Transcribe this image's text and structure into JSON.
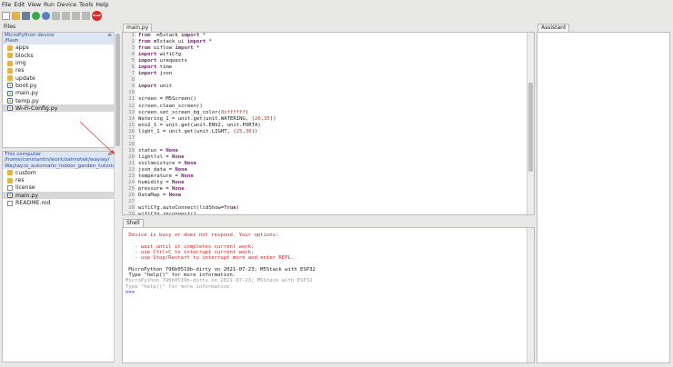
{
  "menu": [
    "File",
    "Edit",
    "View",
    "Run",
    "Device",
    "Tools",
    "Help"
  ],
  "toolbar": {
    "stop_label": "STOP"
  },
  "files_panel": {
    "title": "Files",
    "device": {
      "header": "MicroPython device",
      "path": "/flash",
      "menu_glyph": "≡",
      "items": [
        {
          "name": "apps",
          "type": "folder"
        },
        {
          "name": "blocks",
          "type": "folder"
        },
        {
          "name": "img",
          "type": "folder"
        },
        {
          "name": "res",
          "type": "folder"
        },
        {
          "name": "update",
          "type": "folder"
        },
        {
          "name": "boot.py",
          "type": "py"
        },
        {
          "name": "main.py",
          "type": "py"
        },
        {
          "name": "temp.py",
          "type": "py"
        },
        {
          "name": "Wi-Fi-Config.py",
          "type": "py",
          "selected": true
        }
      ]
    },
    "computer": {
      "header": "This computer",
      "path_line1": "/home/constantin/work/zaimotek/wayiay/",
      "path_line2": "Waylay.io_automatic_indoor_garden_tutorial",
      "menu_glyph": "≡",
      "items": [
        {
          "name": "custom",
          "type": "folder"
        },
        {
          "name": "res",
          "type": "folder"
        },
        {
          "name": "license",
          "type": "txt"
        },
        {
          "name": "main.py",
          "type": "py",
          "selected": true
        },
        {
          "name": "README.md",
          "type": "txt"
        }
      ]
    }
  },
  "editor": {
    "tab": "main.py",
    "lines": [
      [
        [
          "kw",
          "from"
        ],
        [
          "",
          "  m5stack "
        ],
        [
          "kw",
          "import"
        ],
        [
          "",
          " *"
        ]
      ],
      [
        [
          "kw",
          "from"
        ],
        [
          "",
          " m5stack_ui "
        ],
        [
          "kw",
          "import"
        ],
        [
          "",
          " *"
        ]
      ],
      [
        [
          "kw",
          "from"
        ],
        [
          "",
          " uiflow "
        ],
        [
          "kw",
          "import"
        ],
        [
          "",
          " *"
        ]
      ],
      [
        [
          "kw",
          "import"
        ],
        [
          "",
          " wifiCfg"
        ]
      ],
      [
        [
          "kw",
          "import"
        ],
        [
          "",
          " urequests"
        ]
      ],
      [
        [
          "kw",
          "import"
        ],
        [
          "",
          " time"
        ]
      ],
      [
        [
          "kw",
          "import"
        ],
        [
          "",
          " json"
        ]
      ],
      [],
      [
        [
          "kw",
          "import"
        ],
        [
          "",
          " unit"
        ]
      ],
      [],
      [
        [
          "",
          "screen = M5Screen()"
        ]
      ],
      [
        [
          "",
          "screen.clean_screen()"
        ]
      ],
      [
        [
          "",
          "screen.set_screen_bg_color("
        ],
        [
          "num",
          "0xffffff"
        ],
        [
          "",
          ")"
        ]
      ],
      [
        [
          "",
          "Watering_1 = unit.get(unit.WATERING, ("
        ],
        [
          "num",
          "26"
        ],
        [
          "",
          ","
        ],
        [
          "num",
          "35"
        ],
        [
          "",
          "))"
        ]
      ],
      [
        [
          "",
          "env2_1 = unit.get(unit.ENV2, unit.PORTA)"
        ]
      ],
      [
        [
          "",
          "light_1 = unit.get(unit.LIGHT, ("
        ],
        [
          "num",
          "25"
        ],
        [
          "",
          ","
        ],
        [
          "num",
          "36"
        ],
        [
          "",
          "))"
        ]
      ],
      [],
      [],
      [
        [
          "",
          "status = "
        ],
        [
          "kw",
          "None"
        ]
      ],
      [
        [
          "",
          "lightlvl = "
        ],
        [
          "kw",
          "None"
        ]
      ],
      [
        [
          "",
          "soilmoisture = "
        ],
        [
          "kw",
          "None"
        ]
      ],
      [
        [
          "",
          "json_data = "
        ],
        [
          "kw",
          "None"
        ]
      ],
      [
        [
          "",
          "temperature = "
        ],
        [
          "kw",
          "None"
        ]
      ],
      [
        [
          "",
          "humidity = "
        ],
        [
          "kw",
          "None"
        ]
      ],
      [
        [
          "",
          "pressure = "
        ],
        [
          "kw",
          "None"
        ]
      ],
      [
        [
          "",
          "DataMap = "
        ],
        [
          "kw",
          "None"
        ]
      ],
      [],
      [
        [
          "",
          "wifiCfg.autoConnect(lcdShow="
        ],
        [
          "kw",
          "True"
        ],
        [
          "",
          ")"
        ]
      ],
      [
        [
          "",
          "wifiCfg.reconnect()"
        ]
      ]
    ]
  },
  "shell": {
    "tab": "Shell",
    "lines": [
      {
        "cls": "shell-red",
        "text": " Device is busy or does not respond. Your options:"
      },
      {
        "cls": "",
        "text": ""
      },
      {
        "cls": "shell-red",
        "text": "   - wait until it completes current work;"
      },
      {
        "cls": "shell-red",
        "text": "   - use Ctrl+C to interrupt current work;"
      },
      {
        "cls": "shell-red",
        "text": "   - use Stop/Restart to interrupt more and enter REPL."
      },
      {
        "cls": "",
        "text": ""
      },
      {
        "cls": "",
        "text": " MicroPython 796b0519b-dirty on 2021-07-23; M5Stack with ESP32"
      },
      {
        "cls": "",
        "text": " Type \"help()\" for more information."
      },
      {
        "cls": "shell-gray",
        "text": "MicroPython 796b0519b-dirty on 2021-07-23; M5Stack with ESP32"
      },
      {
        "cls": "shell-gray",
        "text": "Type \"help()\" for more information."
      },
      {
        "cls": "shell-blue",
        "text": ">>>"
      }
    ]
  },
  "assistant": {
    "tab": "Assistant"
  },
  "colors": {
    "keyword": "#7a1f7a",
    "number": "#b04020",
    "error": "#d42020",
    "prompt": "#2244cc",
    "selection": "#d8d8d8",
    "stop": "#d62b2b"
  }
}
